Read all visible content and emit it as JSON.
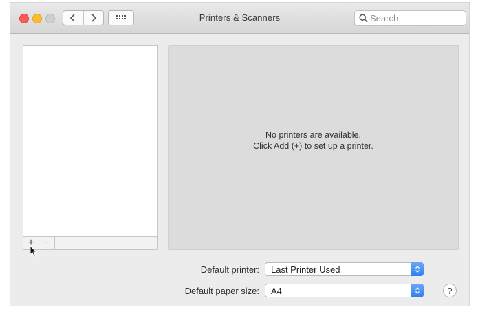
{
  "window": {
    "title": "Printers & Scanners"
  },
  "toolbar": {
    "back_icon": "chevron-left-icon",
    "forward_icon": "chevron-right-icon",
    "grid_icon": "grid-icon",
    "search": {
      "placeholder": "Search",
      "value": ""
    }
  },
  "printer_list": {
    "items": [],
    "add_label": "+",
    "remove_label": "−"
  },
  "detail": {
    "message_line1": "No printers are available.",
    "message_line2": "Click Add (+) to set up a printer."
  },
  "settings": {
    "default_printer_label": "Default printer:",
    "default_printer_value": "Last Printer Used",
    "paper_size_label": "Default paper size:",
    "paper_size_value": "A4"
  },
  "help": {
    "label": "?"
  },
  "colors": {
    "close": "#fc5b57",
    "minimize": "#fdbc2e",
    "zoom": "#cfcfcf",
    "accent": "#2f7ff0"
  }
}
